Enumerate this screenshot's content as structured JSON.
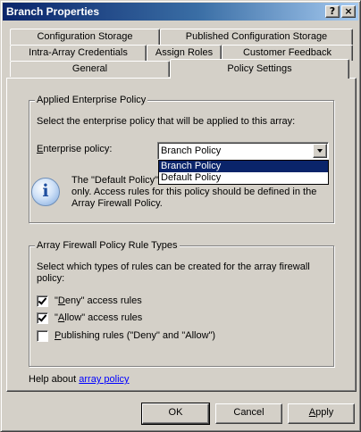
{
  "window": {
    "title": "Branch Properties",
    "help_button": "?",
    "close_button": "×"
  },
  "tabs": {
    "row1": [
      "Configuration Storage",
      "Published Configuration Storage"
    ],
    "row2": [
      "Intra-Array Credentials",
      "Assign Roles",
      "Customer Feedback"
    ],
    "row3": [
      "General",
      "Policy Settings"
    ],
    "active": "Policy Settings"
  },
  "enterprise_group": {
    "legend": "Applied Enterprise Policy",
    "description": "Select the enterprise policy that will be applied to this array:",
    "field_label_prefix": "",
    "field_label_accel": "E",
    "field_label_rest": "nterprise policy:",
    "selected": "Branch Policy",
    "options": [
      "Branch Policy",
      "Default Policy"
    ],
    "info_line1": "The \"Default Policy\"",
    "info_line2": "only. Access rules for this policy should be defined in the",
    "info_line3": "Array Firewall Policy."
  },
  "array_group": {
    "legend": "Array Firewall Policy Rule Types",
    "description_line1": "Select which types of rules can be created for the array firewall",
    "description_line2": "policy:",
    "rules": [
      {
        "pre": "\"",
        "accel": "D",
        "post": "eny\" access rules",
        "checked": true
      },
      {
        "pre": "\"",
        "accel": "A",
        "post": "llow\" access rules",
        "checked": true
      },
      {
        "pre": "",
        "accel": "P",
        "post": "ublishing rules (\"Deny\" and \"Allow\")",
        "checked": false
      }
    ]
  },
  "help": {
    "prefix": "Help about ",
    "link": "array policy"
  },
  "buttons": {
    "ok": "OK",
    "cancel": "Cancel",
    "apply_accel": "A",
    "apply_rest": "pply"
  }
}
